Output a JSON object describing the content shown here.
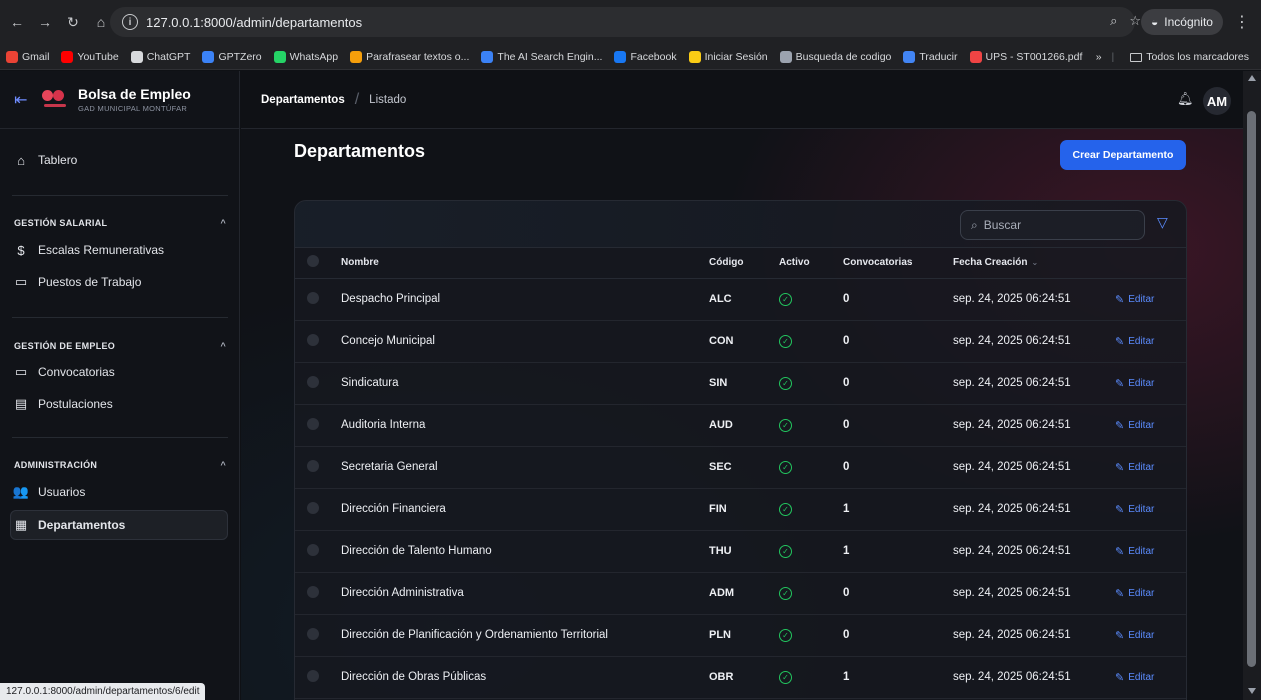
{
  "browser": {
    "url": "127.0.0.1:8000/admin/departamentos",
    "incognito_label": "Incógnito",
    "bookmarks": [
      {
        "label": "Gmail",
        "color": "#ea4335"
      },
      {
        "label": "YouTube",
        "color": "#ff0000"
      },
      {
        "label": "ChatGPT",
        "color": "#d7d9dc"
      },
      {
        "label": "GPTZero",
        "color": "#3b82f6"
      },
      {
        "label": "WhatsApp",
        "color": "#25d366"
      },
      {
        "label": "Parafrasear textos o...",
        "color": "#f59e0b"
      },
      {
        "label": "The AI Search Engin...",
        "color": "#3b82f6"
      },
      {
        "label": "Facebook",
        "color": "#1877f2"
      },
      {
        "label": "Iniciar Sesión",
        "color": "#facc15"
      },
      {
        "label": "Busqueda de codigo",
        "color": "#9ca3af"
      },
      {
        "label": "Traducir",
        "color": "#4285f4"
      },
      {
        "label": "UPS - ST001266.pdf",
        "color": "#ef4444"
      }
    ],
    "more_bookmarks": "»",
    "all_bookmarks": "Todos los marcadores",
    "status_url": "127.0.0.1:8000/admin/departamentos/6/edit"
  },
  "sidebar": {
    "brand_title": "Bolsa de Empleo",
    "brand_subtitle": "GAD MUNICIPAL MONTÚFAR",
    "dashboard": "Tablero",
    "sections": [
      {
        "title": "GESTIÓN SALARIAL",
        "items": [
          "Escalas Remunerativas",
          "Puestos de Trabajo"
        ]
      },
      {
        "title": "GESTIÓN DE EMPLEO",
        "items": [
          "Convocatorias",
          "Postulaciones"
        ]
      },
      {
        "title": "ADMINISTRACIÓN",
        "items": [
          "Usuarios",
          "Departamentos"
        ]
      }
    ]
  },
  "header": {
    "breadcrumb": [
      "Departamentos",
      "Listado"
    ],
    "avatar": "AM"
  },
  "main": {
    "title": "Departamentos",
    "create_button": "Crear Departamento",
    "search_placeholder": "Buscar",
    "columns": [
      "Nombre",
      "Código",
      "Activo",
      "Convocatorias",
      "Fecha Creación"
    ],
    "edit_label": "Editar",
    "accent_color": "#2563eb",
    "active_color": "#22c55e",
    "rows": [
      {
        "nombre": "Despacho Principal",
        "codigo": "ALC",
        "convocatorias": "0",
        "fecha": "sep. 24, 2025 06:24:51"
      },
      {
        "nombre": "Concejo Municipal",
        "codigo": "CON",
        "convocatorias": "0",
        "fecha": "sep. 24, 2025 06:24:51"
      },
      {
        "nombre": "Sindicatura",
        "codigo": "SIN",
        "convocatorias": "0",
        "fecha": "sep. 24, 2025 06:24:51"
      },
      {
        "nombre": "Auditoria Interna",
        "codigo": "AUD",
        "convocatorias": "0",
        "fecha": "sep. 24, 2025 06:24:51"
      },
      {
        "nombre": "Secretaria General",
        "codigo": "SEC",
        "convocatorias": "0",
        "fecha": "sep. 24, 2025 06:24:51"
      },
      {
        "nombre": "Dirección Financiera",
        "codigo": "FIN",
        "convocatorias": "1",
        "fecha": "sep. 24, 2025 06:24:51"
      },
      {
        "nombre": "Dirección de Talento Humano",
        "codigo": "THU",
        "convocatorias": "1",
        "fecha": "sep. 24, 2025 06:24:51"
      },
      {
        "nombre": "Dirección Administrativa",
        "codigo": "ADM",
        "convocatorias": "0",
        "fecha": "sep. 24, 2025 06:24:51"
      },
      {
        "nombre": "Dirección de Planificación y Ordenamiento Territorial",
        "codigo": "PLN",
        "convocatorias": "0",
        "fecha": "sep. 24, 2025 06:24:51"
      },
      {
        "nombre": "Dirección de Obras Públicas",
        "codigo": "OBR",
        "convocatorias": "1",
        "fecha": "sep. 24, 2025 06:24:51"
      }
    ]
  }
}
